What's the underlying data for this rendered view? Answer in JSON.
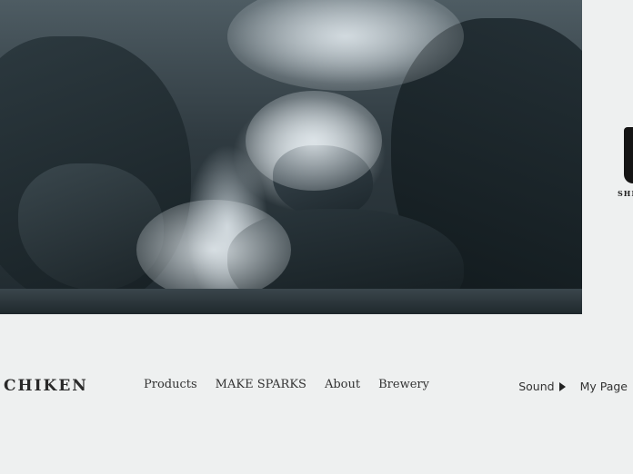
{
  "side_logo": {
    "text": "SHI"
  },
  "brand": {
    "text": "CHIKEN"
  },
  "nav": {
    "items": [
      {
        "label": "Products"
      },
      {
        "label": "MAKE SPARKS"
      },
      {
        "label": "About"
      },
      {
        "label": "Brewery"
      }
    ]
  },
  "utility": {
    "sound_label": "Sound",
    "mypage_label": "My Page"
  }
}
